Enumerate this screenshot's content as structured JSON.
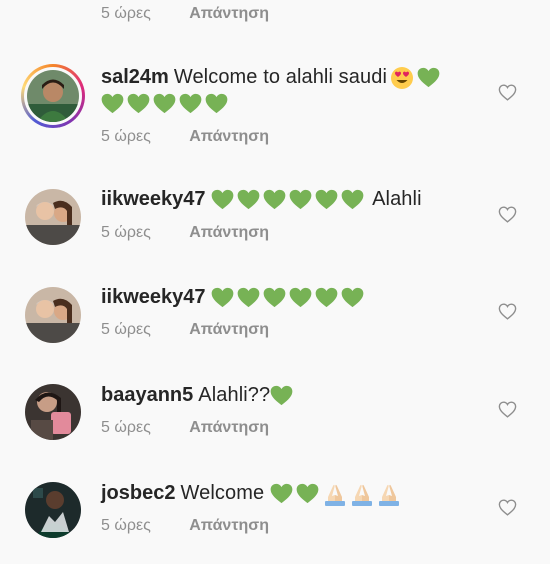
{
  "top_meta": {
    "time": "5 ώρες",
    "reply": "Απάντηση"
  },
  "comments": [
    {
      "username": "sal24m",
      "text": "Welcome to alahli saudi",
      "time": "5 ώρες",
      "reply": "Απάντηση",
      "emoji": [
        "heart-eyes-emoji",
        "green-heart x6"
      ]
    },
    {
      "username": "iikweeky47",
      "text": "Alahli",
      "time": "5 ώρες",
      "reply": "Απάντηση",
      "emoji": [
        "green-heart x6"
      ]
    },
    {
      "username": "iikweeky47",
      "text": "",
      "time": "5 ώρες",
      "reply": "Απάντηση",
      "emoji": [
        "green-heart x6"
      ]
    },
    {
      "username": "baayann5",
      "text": "Alahli??",
      "time": "5 ώρες",
      "reply": "Απάντηση",
      "emoji": [
        "green-heart x1"
      ]
    },
    {
      "username": "josbec2",
      "text": "Welcome",
      "time": "5 ώρες",
      "reply": "Απάντηση",
      "emoji": [
        "green-heart x2",
        "folded-hands x3"
      ]
    }
  ],
  "colors": {
    "heart_green": "#77b255",
    "meta_grey": "#8e8e8e",
    "text": "#262626"
  }
}
